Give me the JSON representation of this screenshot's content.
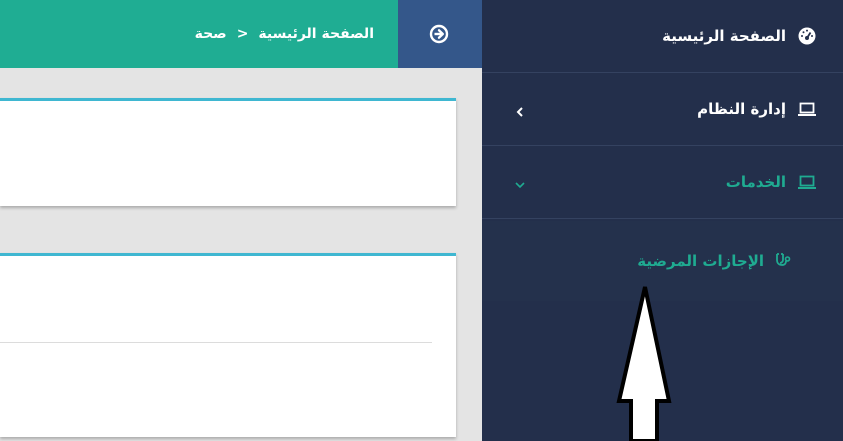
{
  "topbar": {
    "breadcrumb": {
      "home": "الصفحة الرئيسية",
      "separator": "<",
      "current": "صحة"
    },
    "toggle_icon": "arrow-circle-right-icon"
  },
  "sidebar": {
    "items": [
      {
        "label": "الصفحة الرئيسية",
        "icon": "dashboard-icon"
      },
      {
        "label": "إدارة النظام",
        "icon": "laptop-icon",
        "chevron": "chevron-left-icon"
      },
      {
        "label": "الخدمات",
        "icon": "laptop-icon",
        "chevron": "chevron-down-icon",
        "active": true
      }
    ],
    "submenu": [
      {
        "label": "الإجازات المرضية",
        "icon": "stethoscope-icon"
      }
    ]
  },
  "colors": {
    "sidebar_bg": "#232f4b",
    "accent_green": "#1fad93",
    "toggle_bg": "#34578a",
    "card_border": "#3fb7d1",
    "page_bg": "#e4e4e4"
  }
}
